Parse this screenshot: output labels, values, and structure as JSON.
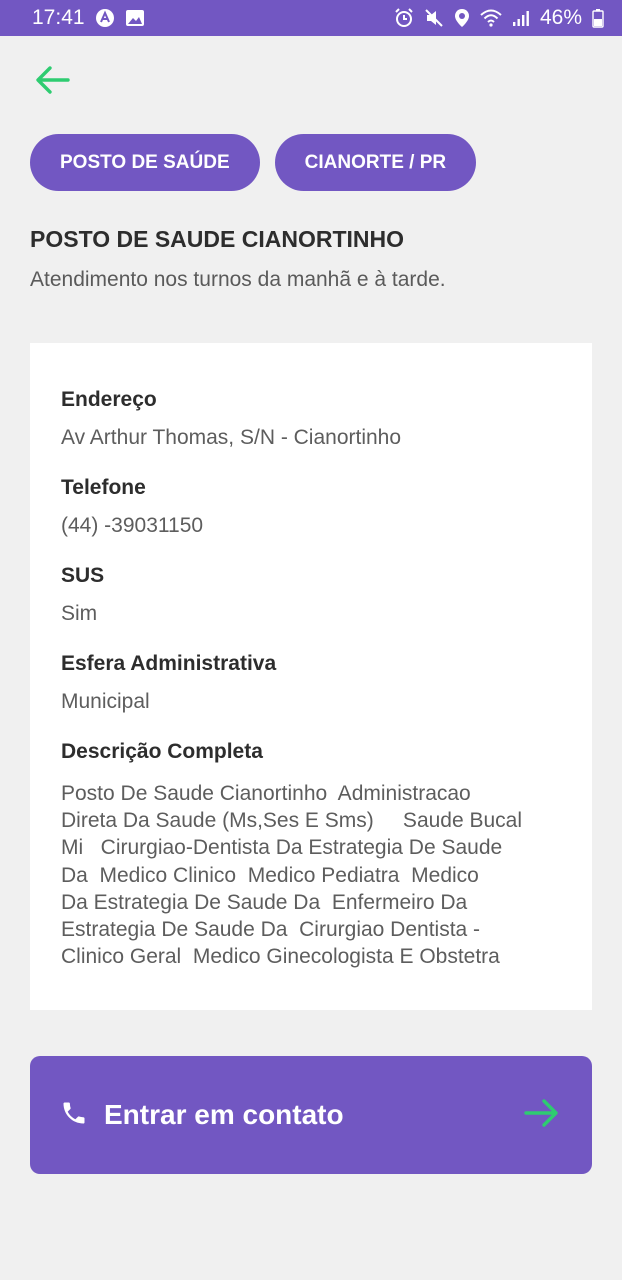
{
  "status_bar": {
    "time": "17:41",
    "battery": "46%",
    "icons": [
      "app-a-icon",
      "image-icon",
      "alarm-icon",
      "mute-icon",
      "location-icon",
      "wifi-icon",
      "signal-icon",
      "battery-icon"
    ]
  },
  "header": {
    "back_icon": "arrow-left-icon",
    "chips": [
      "POSTO DE SAÚDE",
      "CIANORTE / PR"
    ],
    "title": "POSTO DE SAUDE CIANORTINHO",
    "subtitle": "Atendimento nos turnos da manhã e à tarde."
  },
  "details": {
    "address_label": "Endereço",
    "address_value": "Av Arthur Thomas, S/N - Cianortinho",
    "phone_label": "Telefone",
    "phone_value": "(44) -39031150",
    "sus_label": "SUS",
    "sus_value": "Sim",
    "sphere_label": "Esfera Administrativa",
    "sphere_value": "Municipal",
    "description_label": "Descrição Completa",
    "description_value": "Posto De Saude Cianortinho  Administracao\nDireta Da Saude (Ms,Ses E Sms)     Saude Bucal\nMi   Cirurgiao-Dentista Da Estrategia De Saude\nDa  Medico Clinico  Medico Pediatra  Medico\nDa Estrategia De Saude Da  Enfermeiro Da\nEstrategia De Saude Da  Cirurgiao Dentista -\nClinico Geral  Medico Ginecologista E Obstetra"
  },
  "contact_button": {
    "label": "Entrar em contato",
    "icon": "phone-icon",
    "arrow_icon": "arrow-right-icon"
  },
  "colors": {
    "primary": "#7257c2",
    "accent_green": "#2ecc71",
    "background": "#f0f0f0"
  }
}
